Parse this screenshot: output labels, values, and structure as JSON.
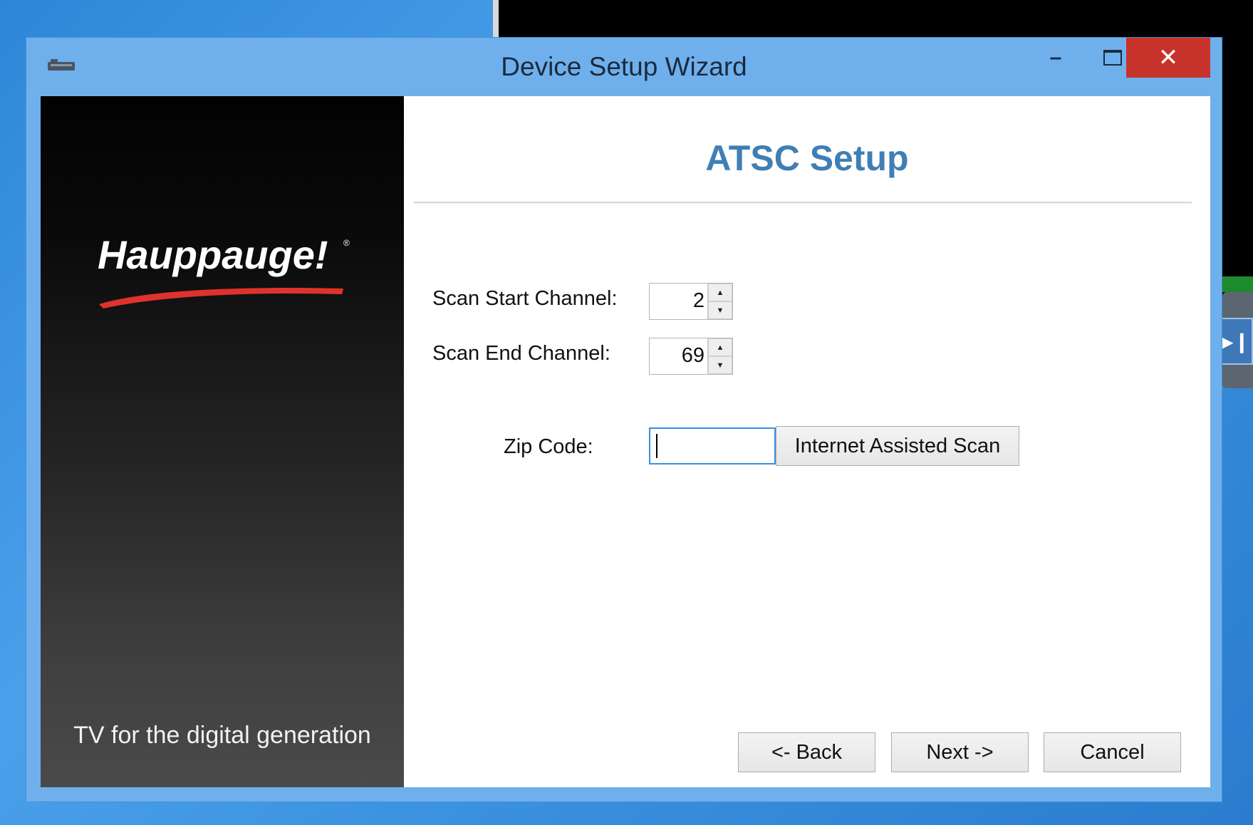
{
  "window": {
    "title": "Device Setup Wizard",
    "close_glyph": "✕",
    "minimize_glyph": "–"
  },
  "brand": {
    "logo_text": "Hauppauge!",
    "tagline": "TV for the digital generation"
  },
  "page": {
    "heading": "ATSC Setup"
  },
  "scan_start": {
    "label": "Scan Start Channel:",
    "value": "2"
  },
  "scan_end": {
    "label": "Scan End Channel:",
    "value": "69"
  },
  "zip": {
    "label": "Zip Code:",
    "value": ""
  },
  "buttons": {
    "internet_assisted_scan": "Internet Assisted Scan",
    "back": "<- Back",
    "next": "Next ->",
    "cancel": "Cancel"
  },
  "colors": {
    "heading": "#3f7fb4",
    "titlebar": "#6fb0ec",
    "close": "#c7332b",
    "logo_swoosh": "#e0322c"
  },
  "icons": {
    "spin_up": "▲",
    "spin_down": "▼",
    "side_widget": "▶❙"
  }
}
